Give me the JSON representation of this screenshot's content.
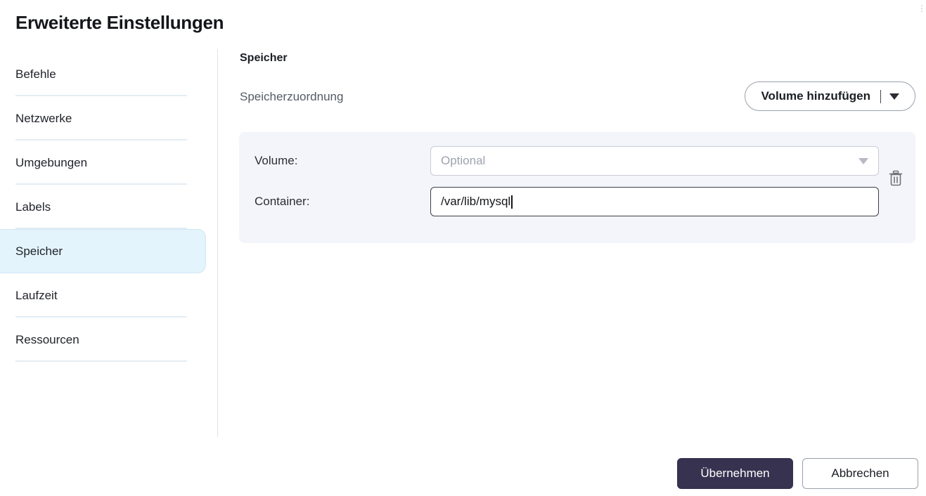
{
  "window": {
    "title": "Erweiterte Einstellungen",
    "corner_glyph": "⋮"
  },
  "sidebar": {
    "items": [
      {
        "label": "Befehle",
        "selected": false
      },
      {
        "label": "Netzwerke",
        "selected": false
      },
      {
        "label": "Umgebungen",
        "selected": false
      },
      {
        "label": "Labels",
        "selected": false
      },
      {
        "label": "Speicher",
        "selected": true
      },
      {
        "label": "Laufzeit",
        "selected": false
      },
      {
        "label": "Ressourcen",
        "selected": false
      }
    ]
  },
  "main": {
    "section_title": "Speicher",
    "mapping_label": "Speicherzuordnung",
    "add_volume_button": {
      "label": "Volume hinzufügen",
      "dropdown_icon": "caret-down-icon"
    },
    "mappings": [
      {
        "volume_label": "Volume:",
        "volume_value": "",
        "volume_placeholder": "Optional",
        "container_label": "Container:",
        "container_value": "/var/lib/mysql",
        "delete_icon": "trash-icon"
      }
    ]
  },
  "footer": {
    "apply_label": "Übernehmen",
    "cancel_label": "Abbrechen"
  },
  "colors": {
    "selected_nav_bg": "#e4f4fc",
    "selected_nav_border": "#cfe7f3",
    "separator": "#e3edf4",
    "card_bg": "#f4f5fa",
    "primary_button": "#373250",
    "focused_border": "#3d4048",
    "placeholder_text": "#9da3ad"
  }
}
